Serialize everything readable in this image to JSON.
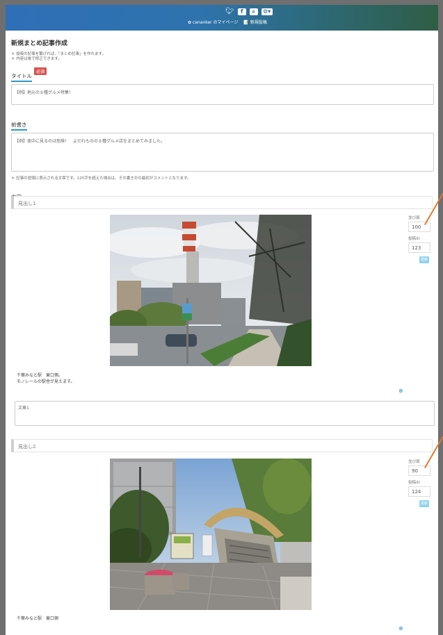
{
  "header": {
    "twitter_icon": "twitter-icon",
    "facebook_icon": "facebook-icon",
    "search_icon": "search-icon",
    "gear_icon": "gear-icon",
    "user_link": "✿ cananker のマイページ",
    "new_post_link": "📝 新規投稿"
  },
  "page": {
    "title": "新規まとめ記事作成",
    "notes": [
      "＊ 投稿の記事を繋げれば、「まとめ記事」を作れます。",
      "＊ 内容は後で修正できます。"
    ],
    "title_label": "タイトル",
    "required_badge": "必須",
    "title_placeholder": "【例】地元の８種グルメ特集！",
    "intro_label": "前書き",
    "intro_placeholder": "【例】夜中に見るのは危険！　よだれものの８種グルメ店をまとめてみました。",
    "intro_note": "＊ 記事の冒頭に表示される文章です。125字を超えた場合は、その書き方の最初がコメントとなります。",
    "content_label": "内容"
  },
  "items": [
    {
      "heading_placeholder": "見出し1",
      "order_label": "並び順",
      "order_value": "100",
      "id_label": "投稿ID",
      "id_value": "123",
      "update_button": "更新",
      "caption": [
        "千葉みなと駅　東口側。",
        "モノレールの駅舎が見えます。"
      ],
      "text_placeholder": "文章1"
    },
    {
      "heading_placeholder": "見出し2",
      "order_label": "並び順",
      "order_value": "90",
      "id_label": "投稿ID",
      "id_value": "124",
      "update_button": "更新",
      "caption": [
        "千葉みなと駅　東口側"
      ]
    }
  ]
}
